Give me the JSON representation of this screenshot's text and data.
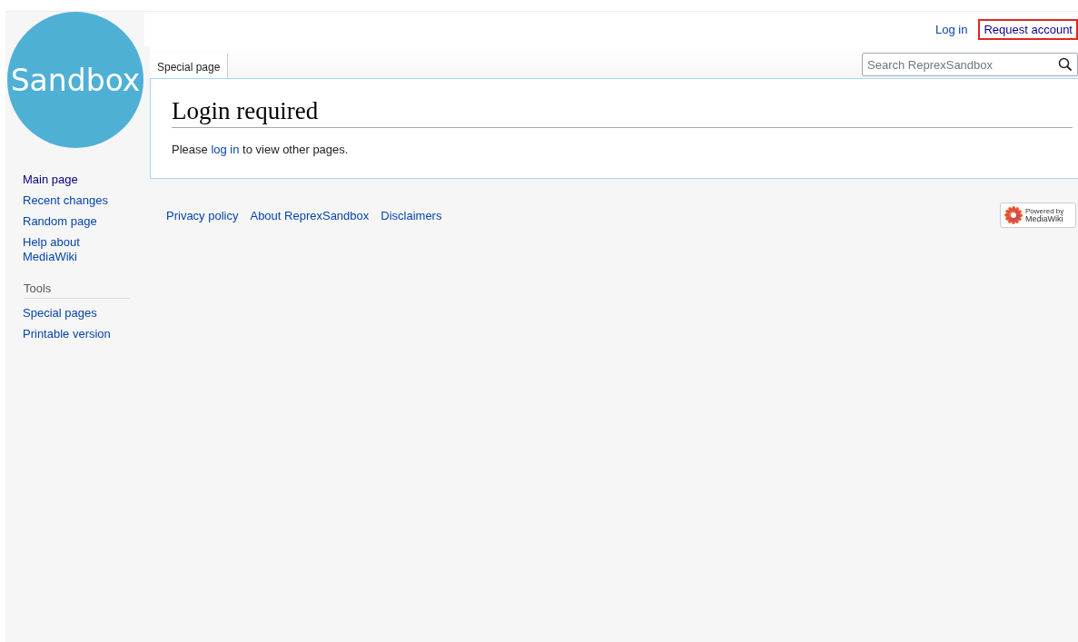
{
  "logo": {
    "text": "Sandbox"
  },
  "personal_links": [
    {
      "label": "Log in",
      "highlighted": false
    },
    {
      "label": "Request account",
      "highlighted": true
    }
  ],
  "tabs": [
    {
      "label": "Special page",
      "selected": true
    }
  ],
  "search": {
    "placeholder": "Search ReprexSandbox"
  },
  "content": {
    "title": "Login required",
    "before": "Please ",
    "link": "log in",
    "after": " to view other pages."
  },
  "navigation": [
    {
      "label": "Main page",
      "visited": true
    },
    {
      "label": "Recent changes",
      "visited": false
    },
    {
      "label": "Random page",
      "visited": false
    },
    {
      "label": "Help about MediaWiki",
      "visited": false
    }
  ],
  "tools": {
    "heading": "Tools",
    "items": [
      {
        "label": "Special pages",
        "visited": false
      },
      {
        "label": "Printable version",
        "visited": false
      }
    ]
  },
  "footer_links": [
    "Privacy policy",
    "About ReprexSandbox",
    "Disclaimers"
  ],
  "powered_badge": {
    "line1": "Powered by",
    "line2": "MediaWiki"
  }
}
